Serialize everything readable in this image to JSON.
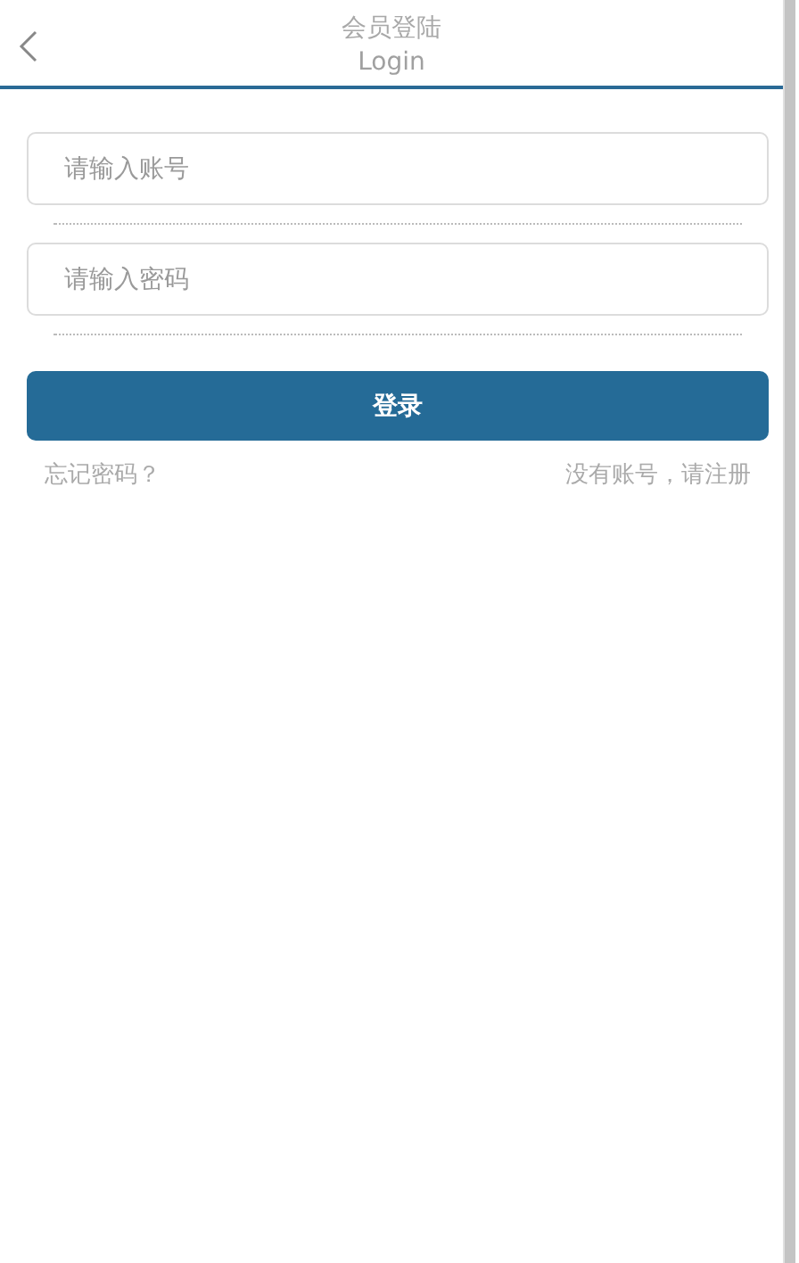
{
  "header": {
    "title": "会员登陆",
    "subtitle": "Login"
  },
  "fields": [
    {
      "placeholder": "请输入账号"
    },
    {
      "placeholder": "请输入密码"
    }
  ],
  "submit": "登录",
  "links": {
    "forgot": "忘记密码？",
    "register": "没有账号，请注册"
  }
}
